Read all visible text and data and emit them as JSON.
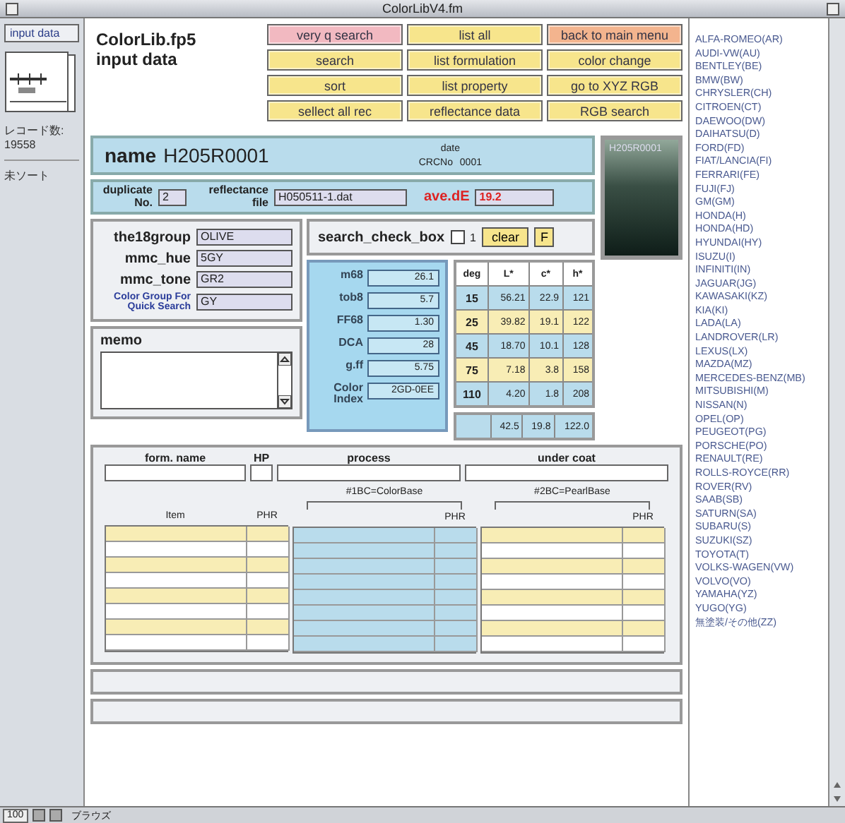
{
  "window": {
    "title": "ColorLibV4.fm"
  },
  "sidebar": {
    "layout_button": "input data",
    "record_count_label": "レコード数:",
    "record_count": "19558",
    "sort_status": "未ソート"
  },
  "header": {
    "title": "ColorLib.fp5",
    "subtitle": "input data"
  },
  "buttons": [
    {
      "label": "very q search",
      "color": "#f2b9c1"
    },
    {
      "label": "list all",
      "color": "#f7e58c"
    },
    {
      "label": "back to main menu",
      "color": "#f3b48e"
    },
    {
      "label": "search",
      "color": "#f7e58c"
    },
    {
      "label": "list formulation",
      "color": "#f7e58c"
    },
    {
      "label": "color change",
      "color": "#f7e58c"
    },
    {
      "label": "sort",
      "color": "#f7e58c"
    },
    {
      "label": "list property",
      "color": "#f7e58c"
    },
    {
      "label": "go to XYZ RGB",
      "color": "#f7e58c"
    },
    {
      "label": "sellect all rec",
      "color": "#f7e58c"
    },
    {
      "label": "reflectance data",
      "color": "#f7e58c"
    },
    {
      "label": "RGB search",
      "color": "#f7e58c"
    }
  ],
  "record": {
    "name_label": "name",
    "name": "H205R0001",
    "date_label": "date",
    "crc_label": "CRCNo",
    "crc": "0001",
    "swatch_label": "H205R0001",
    "duplicate_label": "duplicate No.",
    "duplicate": "2",
    "reflectance_label": "reflectance file",
    "reflectance_file": "H050511-1.dat",
    "ave_de_label": "ave.dE",
    "ave_de": "19.2"
  },
  "groups": [
    {
      "label": "the18group",
      "value": "OLIVE"
    },
    {
      "label": "mmc_hue",
      "value": "5GY"
    },
    {
      "label": "mmc_tone",
      "value": "GR2"
    },
    {
      "label": "Color Group For Quick Search",
      "value": "GY",
      "kind": "quick"
    }
  ],
  "memo": {
    "label": "memo"
  },
  "search_check": {
    "label": "search_check_box",
    "checked": false,
    "option": "1",
    "clear": "clear",
    "flag": "F"
  },
  "properties": [
    {
      "label": "m68",
      "value": "26.1"
    },
    {
      "label": "tob8",
      "value": "5.7"
    },
    {
      "label": "FF68",
      "value": "1.30"
    },
    {
      "label": "DCA",
      "value": "28"
    },
    {
      "label": "g.ff",
      "value": "5.75"
    },
    {
      "label": "Color Index",
      "value": "2GD-0EE"
    }
  ],
  "angles": {
    "columns": [
      "deg",
      "L*",
      "c*",
      "h*"
    ],
    "rows": [
      [
        "15",
        "56.21",
        "22.9",
        "121"
      ],
      [
        "25",
        "39.82",
        "19.1",
        "122"
      ],
      [
        "45",
        "18.70",
        "10.1",
        "128"
      ],
      [
        "75",
        "7.18",
        "3.8",
        "158"
      ],
      [
        "110",
        "4.20",
        "1.8",
        "208"
      ]
    ],
    "totals": [
      "42.5",
      "19.8",
      "122.0"
    ]
  },
  "formulation": {
    "columns": [
      "form. name",
      "HP",
      "process",
      "under coat"
    ],
    "groups": [
      {
        "item_header": "Item",
        "phr_header": "PHR"
      },
      {
        "base": "#1BC=ColorBase",
        "phr_header": "PHR"
      },
      {
        "base": "#2BC=PearlBase",
        "phr_header": "PHR"
      }
    ]
  },
  "brand_list": [
    "ALFA-ROMEO(AR)",
    "AUDI-VW(AU)",
    "BENTLEY(BE)",
    "BMW(BW)",
    "CHRYSLER(CH)",
    "CITROEN(CT)",
    "DAEWOO(DW)",
    "DAIHATSU(D)",
    "FORD(FD)",
    "FIAT/LANCIA(FI)",
    "FERRARI(FE)",
    "FUJI(FJ)",
    "GM(GM)",
    "HONDA(H)",
    "HONDA(HD)",
    "HYUNDAI(HY)",
    "ISUZU(I)",
    "INFINITI(IN)",
    "JAGUAR(JG)",
    "KAWASAKI(KZ)",
    "KIA(KI)",
    "LADA(LA)",
    "LANDROVER(LR)",
    "LEXUS(LX)",
    "MAZDA(MZ)",
    "MERCEDES-BENZ(MB)",
    "MITSUBISHI(M)",
    "NISSAN(N)",
    "OPEL(OP)",
    "PEUGEOT(PG)",
    "PORSCHE(PO)",
    "RENAULT(RE)",
    "ROLLS-ROYCE(RR)",
    "ROVER(RV)",
    "SAAB(SB)",
    "SATURN(SA)",
    "SUBARU(S)",
    "SUZUKI(SZ)",
    "TOYOTA(T)",
    "VOLKS-WAGEN(VW)",
    "VOLVO(VO)",
    "YAMAHA(YZ)",
    "YUGO(YG)",
    "無塗装/その他(ZZ)"
  ],
  "status_bar": {
    "zoom": "100",
    "mode": "ブラウズ"
  }
}
